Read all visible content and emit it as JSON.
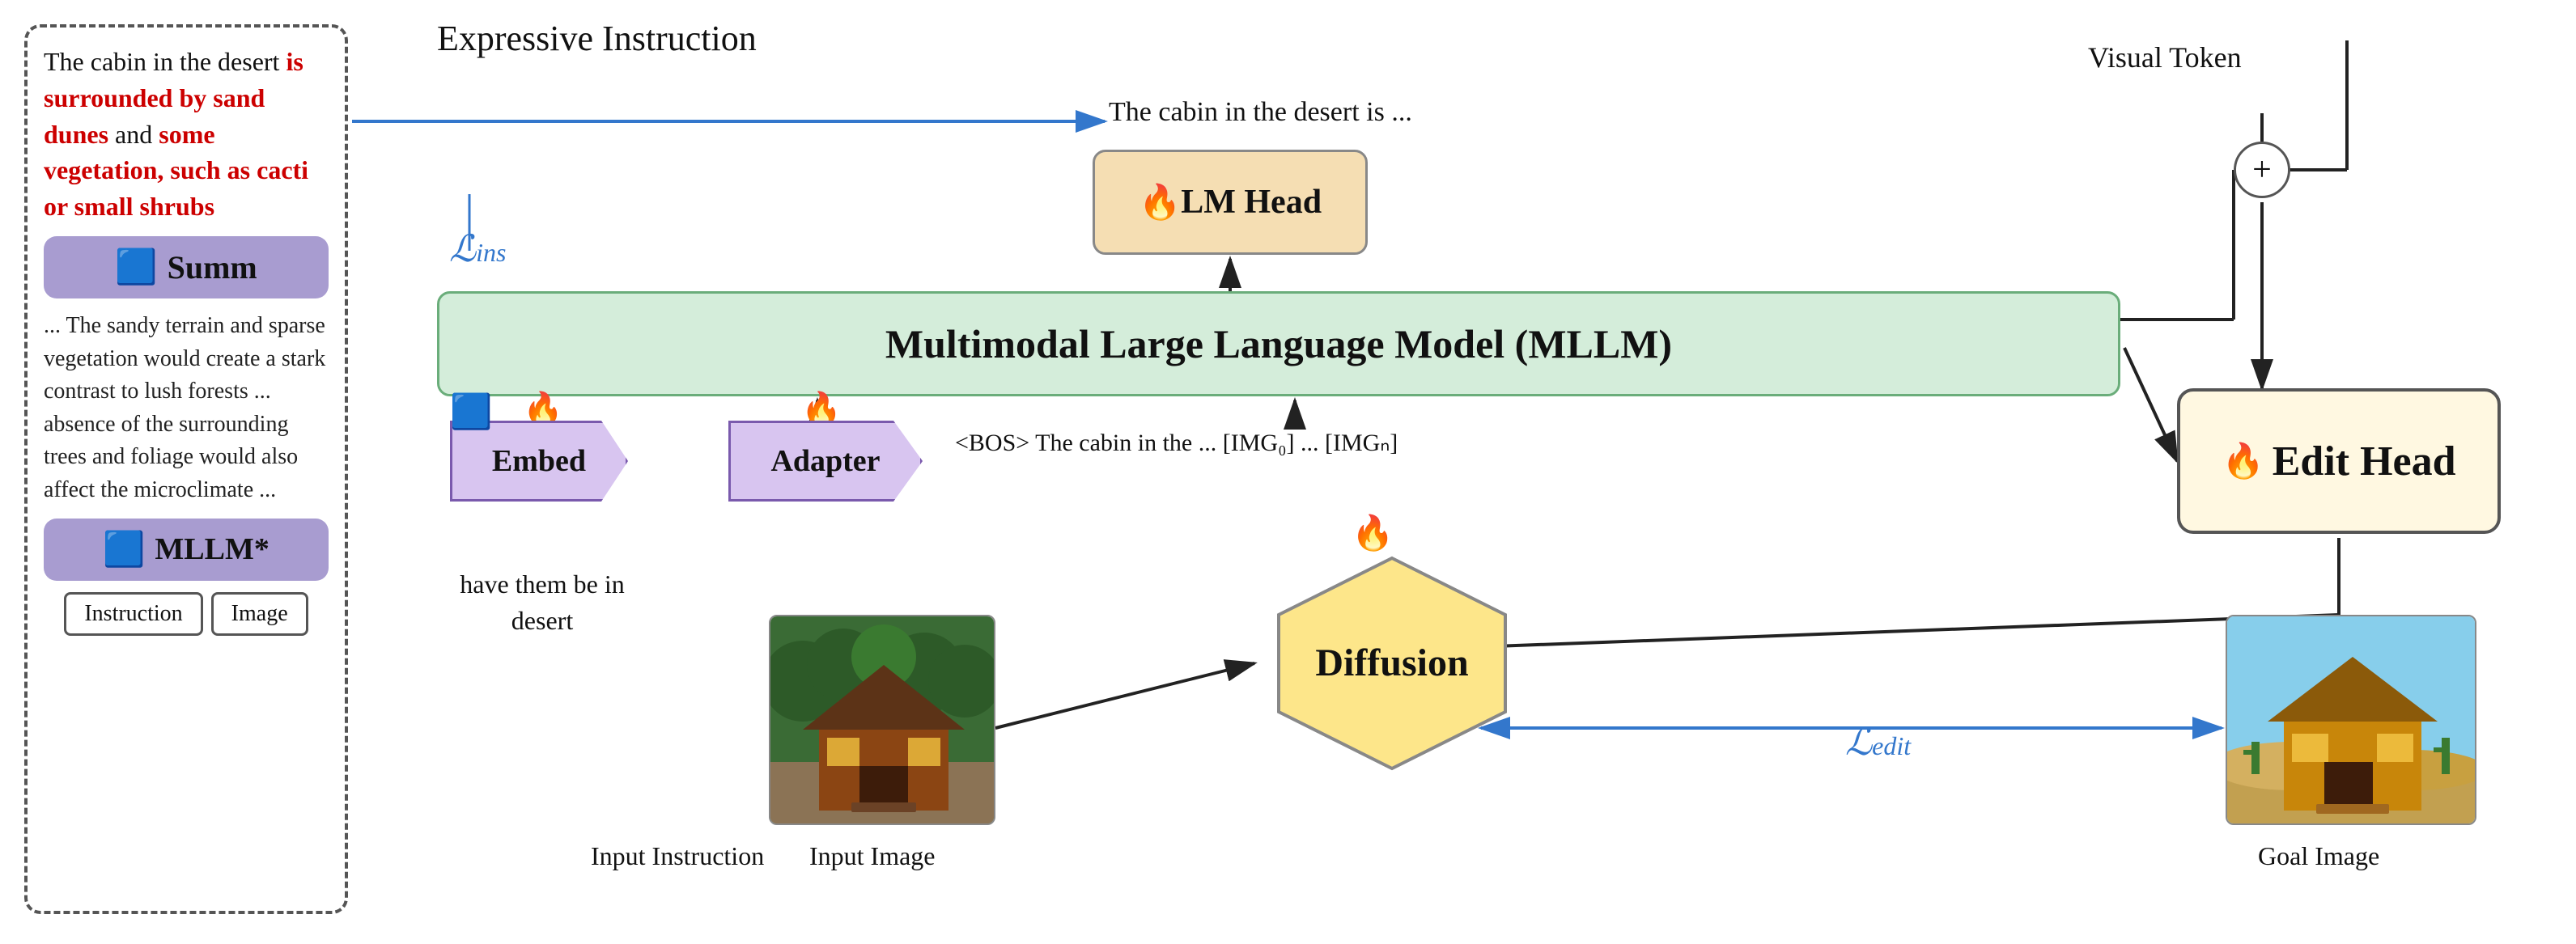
{
  "diagram": {
    "title": "Expressive Instruction",
    "left_box": {
      "instruction_text_black": "The cabin in the desert ",
      "instruction_text_red1": "is surrounded by sand dunes",
      "instruction_text_black2": " and ",
      "instruction_text_red2": "some vegetation, such as cacti or small shrubs",
      "summ_label": "Summ",
      "desc_text": "... The sandy terrain and sparse vegetation would create a stark contrast to lush forests ... absence of the surrounding trees and foliage would also affect the microclimate ...",
      "mllm_label": "MLLM*",
      "instruction_input": "Instruction",
      "image_input": "Image"
    },
    "main": {
      "cabin_text": "The cabin in the desert is ...",
      "lm_head_label": "LM Head",
      "visual_token_label": "Visual Token",
      "mllm_label": "Multimodal Large Language Model (MLLM)",
      "embed_label": "Embed",
      "adapter_label": "Adapter",
      "bos_text": "<BOS> The cabin in the ...   [IMG₀] ... [IMGₙ]",
      "have_them_text": "have them be in desert",
      "diffusion_label": "Diffusion",
      "edit_head_label": "Edit Head",
      "input_instruction_label": "Input Instruction",
      "input_image_label": "Input Image",
      "goal_image_label": "Goal Image",
      "l_ins": "ℒins",
      "l_edit": "ℒedit",
      "plus_symbol": "+"
    },
    "colors": {
      "blue_arrow": "#3377cc",
      "black_arrow": "#222222",
      "mllm_bg": "#d4edda",
      "mllm_border": "#6aad7a",
      "lm_head_bg": "#f5deb3",
      "edit_head_bg": "#fff8e1",
      "embed_bg": "#d8c5f0",
      "adapter_bg": "#d8c5f0",
      "diffusion_bg": "#fde68a",
      "summ_bg": "#a89cd0",
      "mllm_star_bg": "#a89cd0"
    }
  }
}
